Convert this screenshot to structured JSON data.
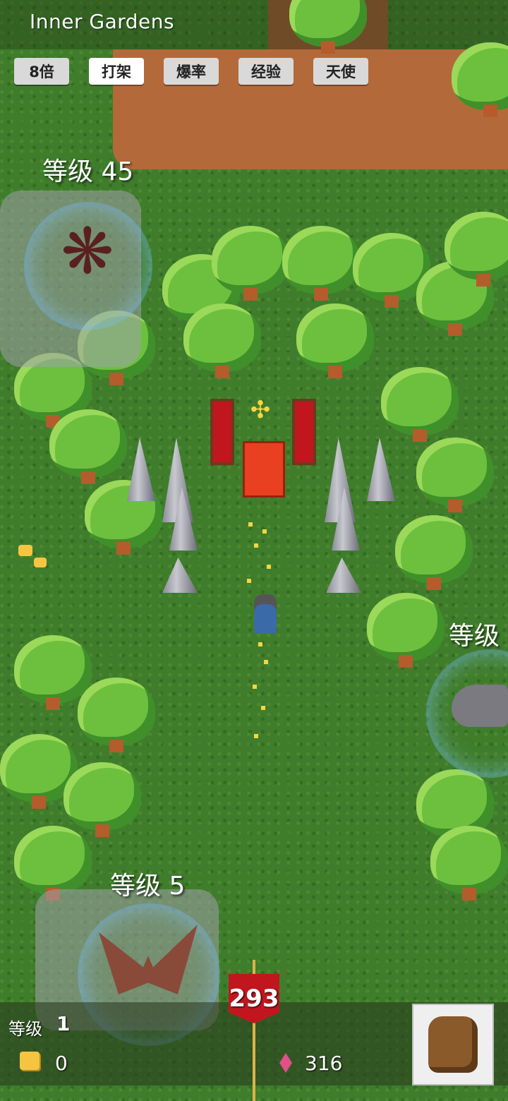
{
  "header": {
    "title": "Inner Gardens"
  },
  "tabs": [
    {
      "label": "8倍"
    },
    {
      "label": "打架",
      "active": true
    },
    {
      "label": "爆率"
    },
    {
      "label": "经验"
    },
    {
      "label": "天使"
    }
  ],
  "enemies": [
    {
      "level_label": "等级 45",
      "creature": "fly-swarm"
    },
    {
      "level_label": "等级",
      "creature": "rat"
    },
    {
      "level_label": "等级 5",
      "creature": "bat"
    }
  ],
  "hud": {
    "level_label": "等级",
    "level_value": "1",
    "gold_value": "0",
    "gem_value": "316",
    "banner_value": "293"
  },
  "icons": {
    "gold": "gold-coins-icon",
    "gem": "pink-gem-icon",
    "bag": "backpack-icon"
  },
  "colors": {
    "grass": "#3f7d2c",
    "path": "#b4693a",
    "banner": "#c2161e",
    "tab_bg": "#d9d9d9"
  }
}
